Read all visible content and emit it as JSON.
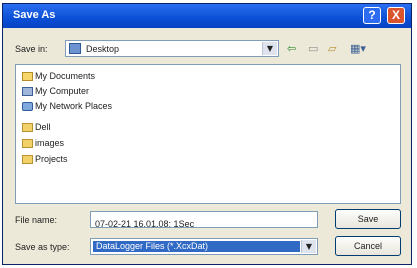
{
  "window": {
    "title": "Save As",
    "help_glyph": "?",
    "close_glyph": "X"
  },
  "save_in": {
    "label": "Save in:",
    "value": "Desktop",
    "dropdown_glyph": "▼"
  },
  "toolbar": {
    "back_glyph": "⇦",
    "up_folder_glyph": "▭",
    "new_folder_glyph": "▱",
    "view_menu_glyph": "▦▾"
  },
  "file_list": {
    "items": [
      {
        "label": "My Documents",
        "icon": "my-documents-icon"
      },
      {
        "label": "My Computer",
        "icon": "my-computer-icon"
      },
      {
        "label": "My Network Places",
        "icon": "my-network-places-icon"
      },
      {
        "label": "Dell",
        "icon": "folder-icon"
      },
      {
        "label": "images",
        "icon": "folder-icon"
      },
      {
        "label": "Projects",
        "icon": "folder-icon"
      }
    ]
  },
  "file_name": {
    "label": "File name:",
    "value": "07-02-21 16.01.08: 1Sec"
  },
  "save_as_type": {
    "label": "Save as type:",
    "value": "DataLogger Files (*.XcxDat)",
    "dropdown_glyph": "▼"
  },
  "buttons": {
    "save": "Save",
    "cancel": "Cancel"
  }
}
